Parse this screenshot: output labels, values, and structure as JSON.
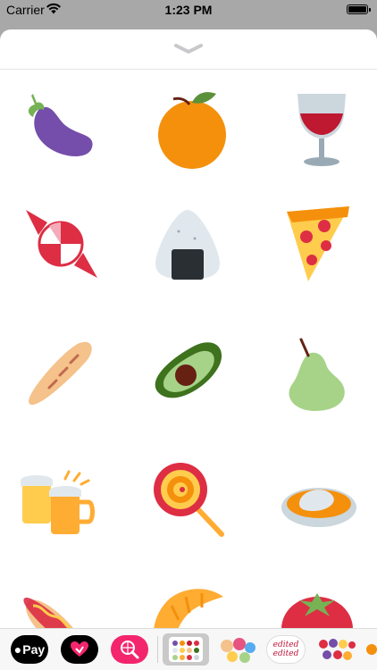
{
  "status_bar": {
    "carrier": "Carrier",
    "time": "1:23 PM"
  },
  "stickers": [
    {
      "icon": "eggplant-sticker"
    },
    {
      "icon": "orange-sticker"
    },
    {
      "icon": "wine-glass-sticker"
    },
    {
      "icon": "candy-sticker"
    },
    {
      "icon": "rice-ball-sticker"
    },
    {
      "icon": "pizza-slice-sticker"
    },
    {
      "icon": "baguette-sticker"
    },
    {
      "icon": "avocado-sticker"
    },
    {
      "icon": "pear-sticker"
    },
    {
      "icon": "beer-mugs-sticker"
    },
    {
      "icon": "lollipop-sticker"
    },
    {
      "icon": "curry-rice-sticker"
    },
    {
      "icon": "hot-dog-sticker"
    },
    {
      "icon": "croissant-sticker"
    },
    {
      "icon": "tomato-sticker"
    }
  ],
  "app_drawer": {
    "apple_pay_label": "Pay",
    "edited_line1": "edited",
    "edited_line2": "edited"
  },
  "colors": {
    "pay_pink": "#f3266d",
    "sheet_bg": "#ffffff",
    "backdrop": "#a8a8a8"
  }
}
